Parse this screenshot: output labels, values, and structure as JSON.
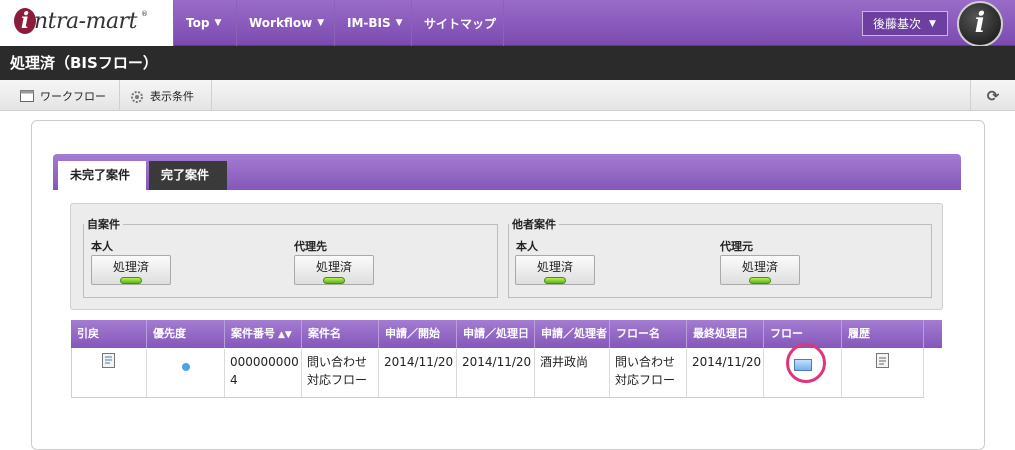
{
  "header": {
    "logo": "intra-mart",
    "nav": [
      {
        "label": "Top",
        "dropdown": true
      },
      {
        "label": "Workflow",
        "dropdown": true
      },
      {
        "label": "IM-BIS",
        "dropdown": true
      },
      {
        "label": "サイトマップ",
        "dropdown": false
      }
    ],
    "user": "後藤基次"
  },
  "page_title": "処理済（BISフロー）",
  "toolbar": {
    "workflow": "ワークフロー",
    "display_conditions": "表示条件"
  },
  "tabs": [
    {
      "label": "未完了案件",
      "active": true
    },
    {
      "label": "完了案件",
      "active": false
    }
  ],
  "filters": {
    "own": {
      "legend": "自案件",
      "groups": [
        {
          "label": "本人",
          "button": "処理済"
        },
        {
          "label": "代理先",
          "button": "処理済"
        }
      ]
    },
    "others": {
      "legend": "他者案件",
      "groups": [
        {
          "label": "本人",
          "button": "処理済"
        },
        {
          "label": "代理元",
          "button": "処理済"
        }
      ]
    }
  },
  "grid": {
    "columns": [
      "引戻",
      "優先度",
      "案件番号",
      "案件名",
      "申請／開始",
      "申請／処理日",
      "申請／処理者",
      "フロー名",
      "最終処理日",
      "フロー",
      "履歴"
    ],
    "rows": [
      {
        "case_no_line1": "000000000",
        "case_no_line2": "4",
        "case_name_line1": "問い合わせ",
        "case_name_line2": "対応フロー",
        "apply_start": "2014/11/20",
        "apply_date": "2014/11/20",
        "apply_user": "酒井政尚",
        "flow_name_line1": "問い合わせ",
        "flow_name_line2": "対応フロー",
        "last_date": "2014/11/20"
      }
    ]
  }
}
